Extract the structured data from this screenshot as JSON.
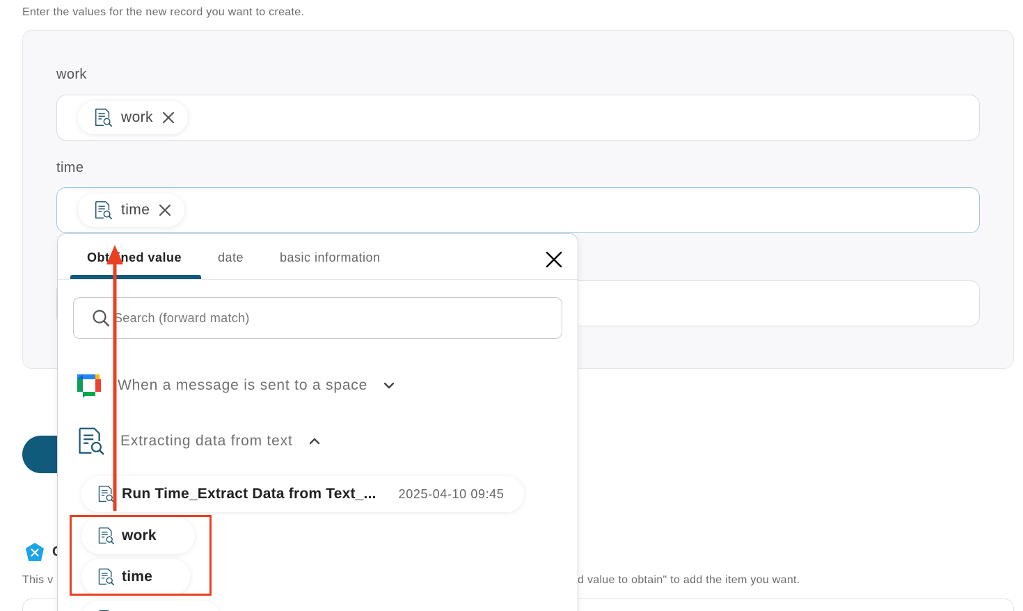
{
  "intro_text": "Enter the values for the new record you want to create.",
  "fields": [
    {
      "label": "work",
      "chip": "work"
    },
    {
      "label": "time",
      "chip": "time"
    }
  ],
  "dropdown": {
    "tabs": [
      {
        "label": "Obtained value",
        "active": true
      },
      {
        "label": "date",
        "active": false
      },
      {
        "label": "basic information",
        "active": false
      }
    ],
    "search_placeholder": "Search (forward match)",
    "groups": [
      {
        "title": "When a message is sent to a space",
        "expanded": false,
        "icon": "google-chat-icon"
      },
      {
        "title": "Extracting data from text",
        "expanded": true,
        "icon": "document-search-icon"
      }
    ],
    "items": [
      {
        "label": "Run Time_Extract Data from Text_...",
        "time": "2025-04-10 09:45"
      },
      {
        "label": "work"
      },
      {
        "label": "time"
      }
    ]
  },
  "lower": {
    "left_text": "This v",
    "left_char": "C",
    "right_text": "d value to obtain\" to add the item you want."
  },
  "colors": {
    "accent": "#105a7c",
    "highlight": "#ea4020",
    "focus_border": "#9cc6e0"
  }
}
